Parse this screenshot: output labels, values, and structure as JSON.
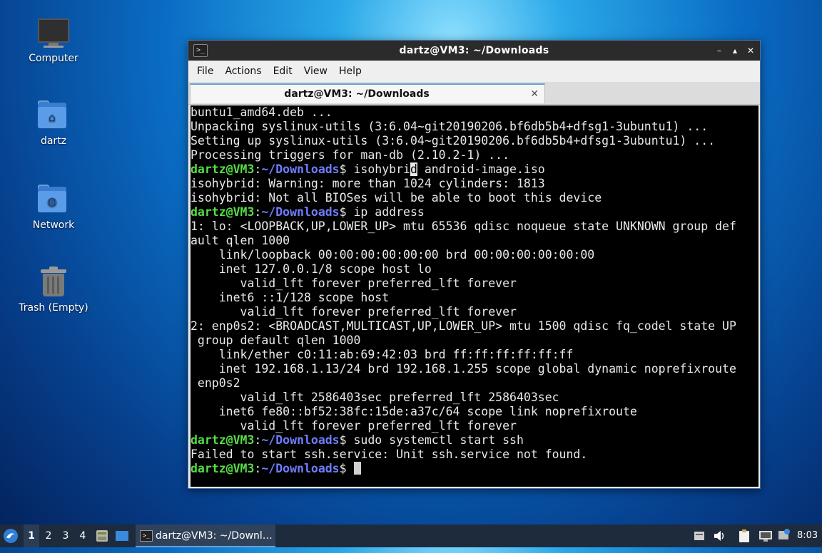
{
  "desktop": {
    "icons": [
      {
        "label": "Computer",
        "icon": "computer-icon"
      },
      {
        "label": "dartz",
        "icon": "home-folder-icon"
      },
      {
        "label": "Network",
        "icon": "network-folder-icon"
      },
      {
        "label": "Trash (Empty)",
        "icon": "trash-icon"
      }
    ]
  },
  "window": {
    "title": "dartz@VM3: ~/Downloads",
    "controls": {
      "minimize": "–",
      "maximize": "▴",
      "close": "✕"
    },
    "menu": [
      "File",
      "Actions",
      "Edit",
      "View",
      "Help"
    ],
    "tab": {
      "label": "dartz@VM3: ~/Downloads",
      "close": "✕"
    }
  },
  "terminal": {
    "prompt_user": "dartz@VM3",
    "prompt_sep": ":",
    "prompt_path": "~/Downloads",
    "prompt_end": "$ ",
    "lines": [
      "buntu1_amd64.deb ...",
      "Unpacking syslinux-utils (3:6.04~git20190206.bf6db5b4+dfsg1-3ubuntu1) ...",
      "Setting up syslinux-utils (3:6.04~git20190206.bf6db5b4+dfsg1-3ubuntu1) ...",
      "Processing triggers for man-db (2.10.2-1) ...",
      {
        "cmd_pre": "isohybri",
        "cmd_cursor": "d",
        "cmd_post": " android-image.iso"
      },
      "isohybrid: Warning: more than 1024 cylinders: 1813",
      "isohybrid: Not all BIOSes will be able to boot this device",
      {
        "cmd": "ip address"
      },
      "1: lo: <LOOPBACK,UP,LOWER_UP> mtu 65536 qdisc noqueue state UNKNOWN group def",
      "ault qlen 1000",
      "    link/loopback 00:00:00:00:00:00 brd 00:00:00:00:00:00",
      "    inet 127.0.0.1/8 scope host lo",
      "       valid_lft forever preferred_lft forever",
      "    inet6 ::1/128 scope host",
      "       valid_lft forever preferred_lft forever",
      "2: enp0s2: <BROADCAST,MULTICAST,UP,LOWER_UP> mtu 1500 qdisc fq_codel state UP",
      " group default qlen 1000",
      "    link/ether c0:11:ab:69:42:03 brd ff:ff:ff:ff:ff:ff",
      "    inet 192.168.1.13/24 brd 192.168.1.255 scope global dynamic noprefixroute",
      " enp0s2",
      "       valid_lft 2586403sec preferred_lft 2586403sec",
      "    inet6 fe80::bf52:38fc:15de:a37c/64 scope link noprefixroute",
      "       valid_lft forever preferred_lft forever",
      {
        "cmd": "sudo systemctl start ssh"
      },
      "Failed to start ssh.service: Unit ssh.service not found.",
      {
        "cmd": "",
        "cursor": true
      }
    ]
  },
  "taskbar": {
    "workspaces": [
      "1",
      "2",
      "3",
      "4"
    ],
    "active_workspace": "1",
    "task_label": "dartz@VM3: ~/Downl…",
    "clock": "8:03"
  },
  "colors": {
    "prompt_user": "#55dd44",
    "prompt_path": "#6f7dff",
    "terminal_bg": "#000000",
    "taskbar_bg": "#1e2b3d"
  }
}
